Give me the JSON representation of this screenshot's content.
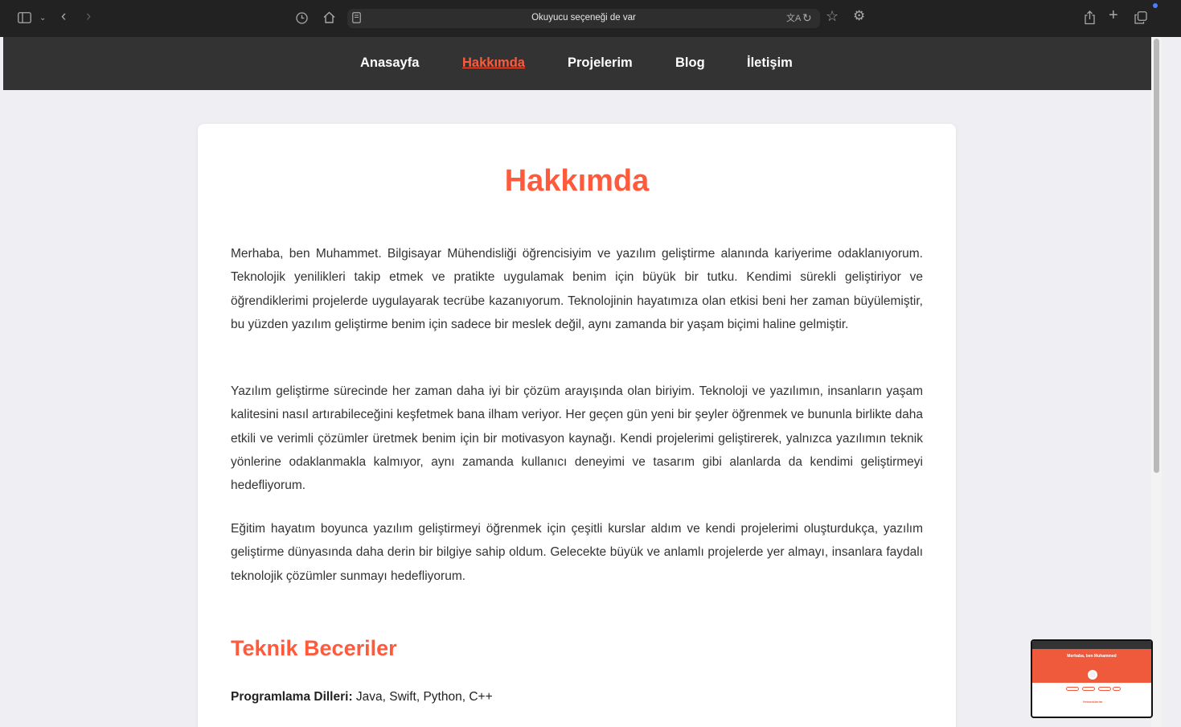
{
  "browser": {
    "address_text": "Okuyucu seçeneği de var",
    "icons": [
      "sidebar-icon",
      "chevron-down-icon",
      "back-icon",
      "forward-icon",
      "history-icon",
      "home-icon",
      "reader-icon",
      "translate-icon",
      "reload-icon",
      "bookmark-star-icon",
      "settings-icon",
      "share-icon",
      "new-tab-icon",
      "tabs-overview-icon"
    ]
  },
  "nav": {
    "items": [
      {
        "label": "Anasayfa"
      },
      {
        "label": "Hakkımda"
      },
      {
        "label": "Projelerim"
      },
      {
        "label": "Blog"
      },
      {
        "label": "İletişim"
      }
    ],
    "active": "Hakkımda"
  },
  "about": {
    "title": "Hakkımda",
    "paragraphs": [
      "Merhaba, ben Muhammet. Bilgisayar Mühendisliği öğrencisiyim ve yazılım geliştirme alanında kariyerime odaklanıyorum. Teknolojik yenilikleri takip etmek ve pratikte uygulamak benim için büyük bir tutku. Kendimi sürekli geliştiriyor ve öğrendiklerimi projelerde uygulayarak tecrübe kazanıyorum. Teknolojinin hayatımıza olan etkisi beni her zaman büyülemiştir, bu yüzden yazılım geliştirme benim için sadece bir meslek değil, aynı zamanda bir yaşam biçimi haline gelmiştir.",
      "Yazılım geliştirme sürecinde her zaman daha iyi bir çözüm arayışında olan biriyim. Teknoloji ve yazılımın, insanların yaşam kalitesini nasıl artırabileceğini keşfetmek bana ilham veriyor. Her geçen gün yeni bir şeyler öğrenmek ve bununla birlikte daha etkili ve verimli çözümler üretmek benim için bir motivasyon kaynağı. Kendi projelerimi geliştirerek, yalnızca yazılımın teknik yönlerine odaklanmakla kalmıyor, aynı zamanda kullanıcı deneyimi ve tasarım gibi alanlarda da kendimi geliştirmeyi hedefliyorum.",
      "Eğitim hayatım boyunca yazılım geliştirmeyi öğrenmek için çeşitli kurslar aldım ve kendi projelerimi oluşturdukça, yazılım geliştirme dünyasında daha derin bir bilgiye sahip oldum. Gelecekte büyük ve anlamlı projelerde yer almayı, insanlara faydalı teknolojik çözümler sunmayı hedefliyorum."
    ]
  },
  "skills": {
    "heading": "Teknik Beceriler",
    "programming_label": "Programlama Dilleri:",
    "programming_value": " Java, Swift, Python, C++"
  },
  "preview": {
    "title": "Merhaba, ben Muhammed",
    "subtitle": "Yeteneklerim"
  },
  "colors": {
    "accent": "#ff5a3c",
    "nav_bg": "#333333",
    "page_bg": "#efeef3",
    "toolbar_bg": "#222222"
  }
}
